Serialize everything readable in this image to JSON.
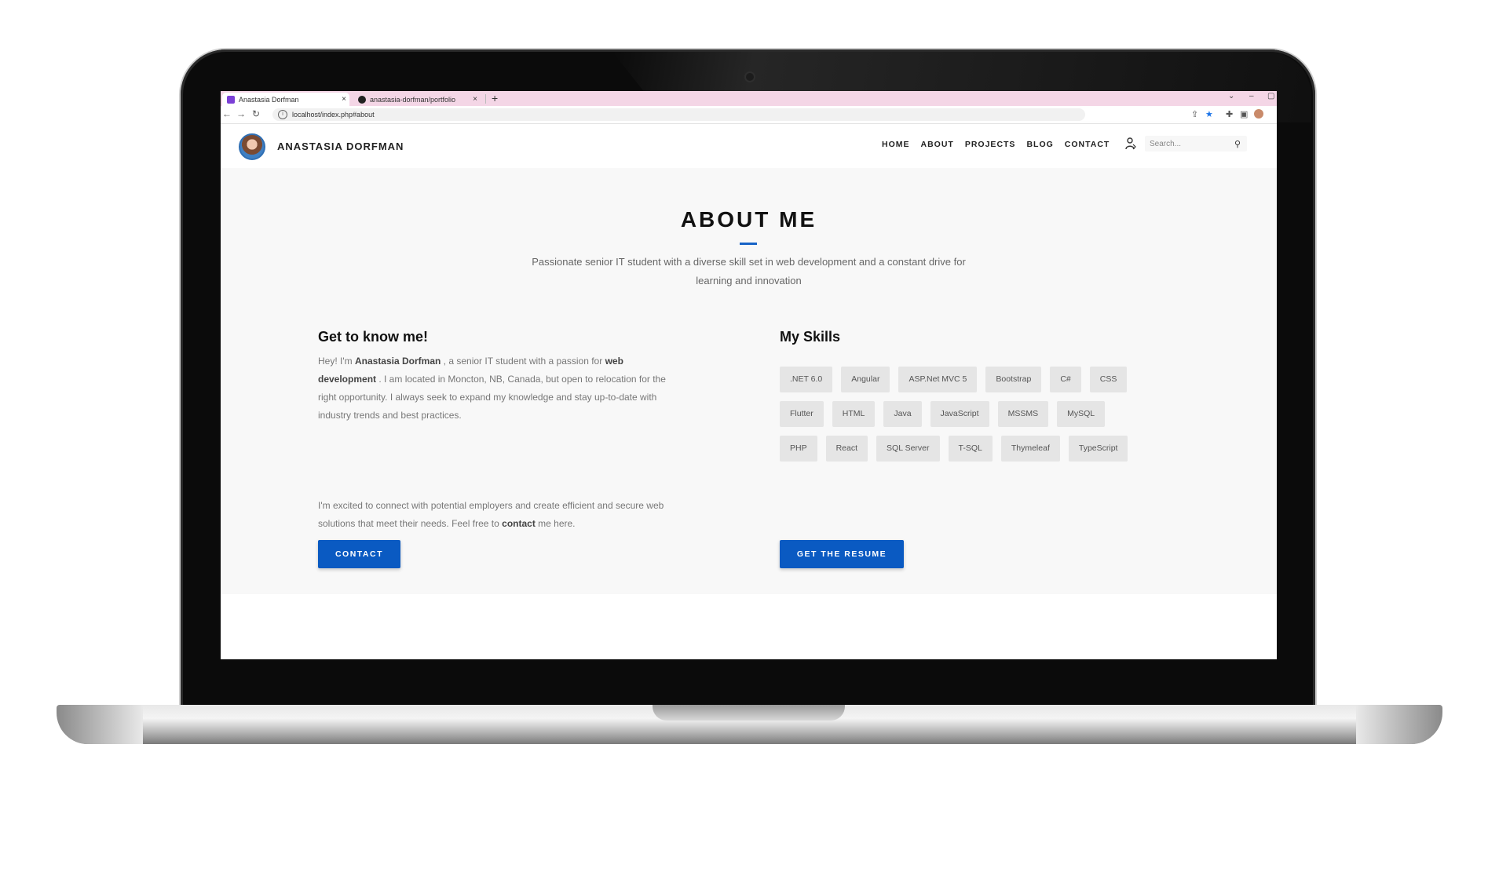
{
  "browser": {
    "tabs": [
      {
        "title": "Anastasia Dorfman",
        "favicon_color": "#7b3fd6",
        "active": true
      },
      {
        "title": "anastasia-dorfman/portfolio",
        "favicon_color": "#222222",
        "active": false
      }
    ],
    "new_tab_symbol": "+",
    "close_symbol": "×",
    "url": "localhost/index.php#about",
    "window_controls": [
      "⌄",
      "–",
      "▢"
    ]
  },
  "header": {
    "site_name": "ANASTASIA DORFMAN",
    "nav": [
      "HOME",
      "ABOUT",
      "PROJECTS",
      "BLOG",
      "CONTACT"
    ],
    "search_placeholder": "Search..."
  },
  "about": {
    "title": "ABOUT ME",
    "subtitle_line1": "Passionate senior IT student with a diverse skill set in web development and a constant drive for",
    "subtitle_line2": "learning and innovation",
    "left": {
      "heading": "Get to know me!",
      "p1_a": "Hey! I'm ",
      "p1_name": "Anastasia Dorfman",
      "p1_b": " , a senior IT student with a passion for ",
      "p1_strong": "web development",
      "p1_c": " . I am located in Moncton, NB, Canada, but open to relocation for the right opportunity. I always seek to expand my knowledge and stay up-to-date with industry trends and best practices.",
      "p2_a": "I'm excited to connect with potential employers and create efficient and secure web solutions that meet their needs. Feel free to ",
      "p2_strong": "contact",
      "p2_b": " me here.",
      "button": "CONTACT"
    },
    "right": {
      "heading": "My Skills",
      "skills_rows": [
        [
          ".NET 6.0",
          "Angular",
          "ASP.Net MVC 5",
          "Bootstrap",
          "C#",
          "CSS"
        ],
        [
          "Flutter",
          "HTML",
          "Java",
          "JavaScript",
          "MSSMS",
          "MySQL"
        ],
        [
          "PHP",
          "React",
          "SQL Server",
          "T-SQL",
          "Thymeleaf",
          "TypeScript"
        ]
      ],
      "button": "GET THE RESUME"
    }
  },
  "colors": {
    "accent": "#0a5ac2",
    "tab_strip": "#f4d6e6"
  }
}
